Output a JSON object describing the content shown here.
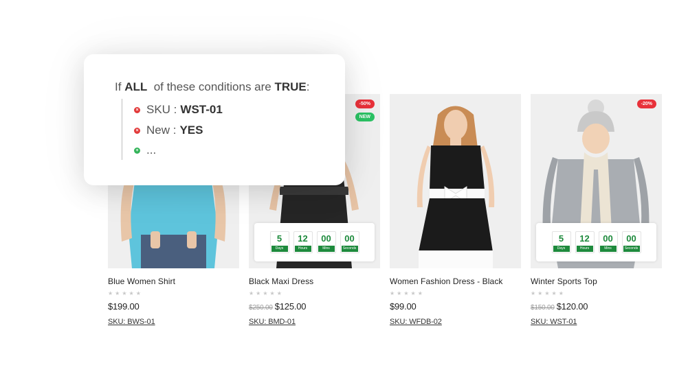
{
  "condition_popup": {
    "prefix": "If",
    "all_word": "ALL",
    "middle": "of these conditions are",
    "true_word": "TRUE",
    "suffix": ":",
    "conditions": [
      {
        "field": "SKU :",
        "value": "WST-01",
        "icon": "remove-icon",
        "color": "#e23a3a"
      },
      {
        "field": "New :",
        "value": "YES",
        "icon": "remove-icon",
        "color": "#e23a3a"
      },
      {
        "field": "...",
        "value": "",
        "icon": "add-icon",
        "color": "#34b45a"
      }
    ]
  },
  "products": [
    {
      "name": "Blue Women Shirt",
      "rating": 0,
      "old_price": "",
      "price": "$199.00",
      "sku": "SKU: BWS-01"
    },
    {
      "name": "Black Maxi Dress",
      "rating": 0,
      "old_price": "$250.00",
      "price": "$125.00",
      "sku": "SKU: BMD-01",
      "sale_badge": "-50%",
      "new_badge": "NEW",
      "countdown": [
        {
          "value": "5",
          "label": "Days"
        },
        {
          "value": "12",
          "label": "Hours"
        },
        {
          "value": "00",
          "label": "Mins"
        },
        {
          "value": "00",
          "label": "Seconds"
        }
      ]
    },
    {
      "name": "Women Fashion Dress - Black",
      "rating": 0,
      "old_price": "",
      "price": "$99.00",
      "sku": "SKU: WFDB-02"
    },
    {
      "name": "Winter Sports Top",
      "rating": 0,
      "old_price": "$150.00",
      "price": "$120.00",
      "sku": "SKU: WST-01",
      "sale_badge": "-20%",
      "countdown": [
        {
          "value": "5",
          "label": "Days"
        },
        {
          "value": "12",
          "label": "Hours"
        },
        {
          "value": "00",
          "label": "Mins"
        },
        {
          "value": "00",
          "label": "Seconds"
        }
      ]
    }
  ],
  "colors": {
    "sale_badge": "#e8313a",
    "new_badge": "#2cc264",
    "countdown_green": "#1d8a3c",
    "star_empty": "#c8c8c8"
  }
}
